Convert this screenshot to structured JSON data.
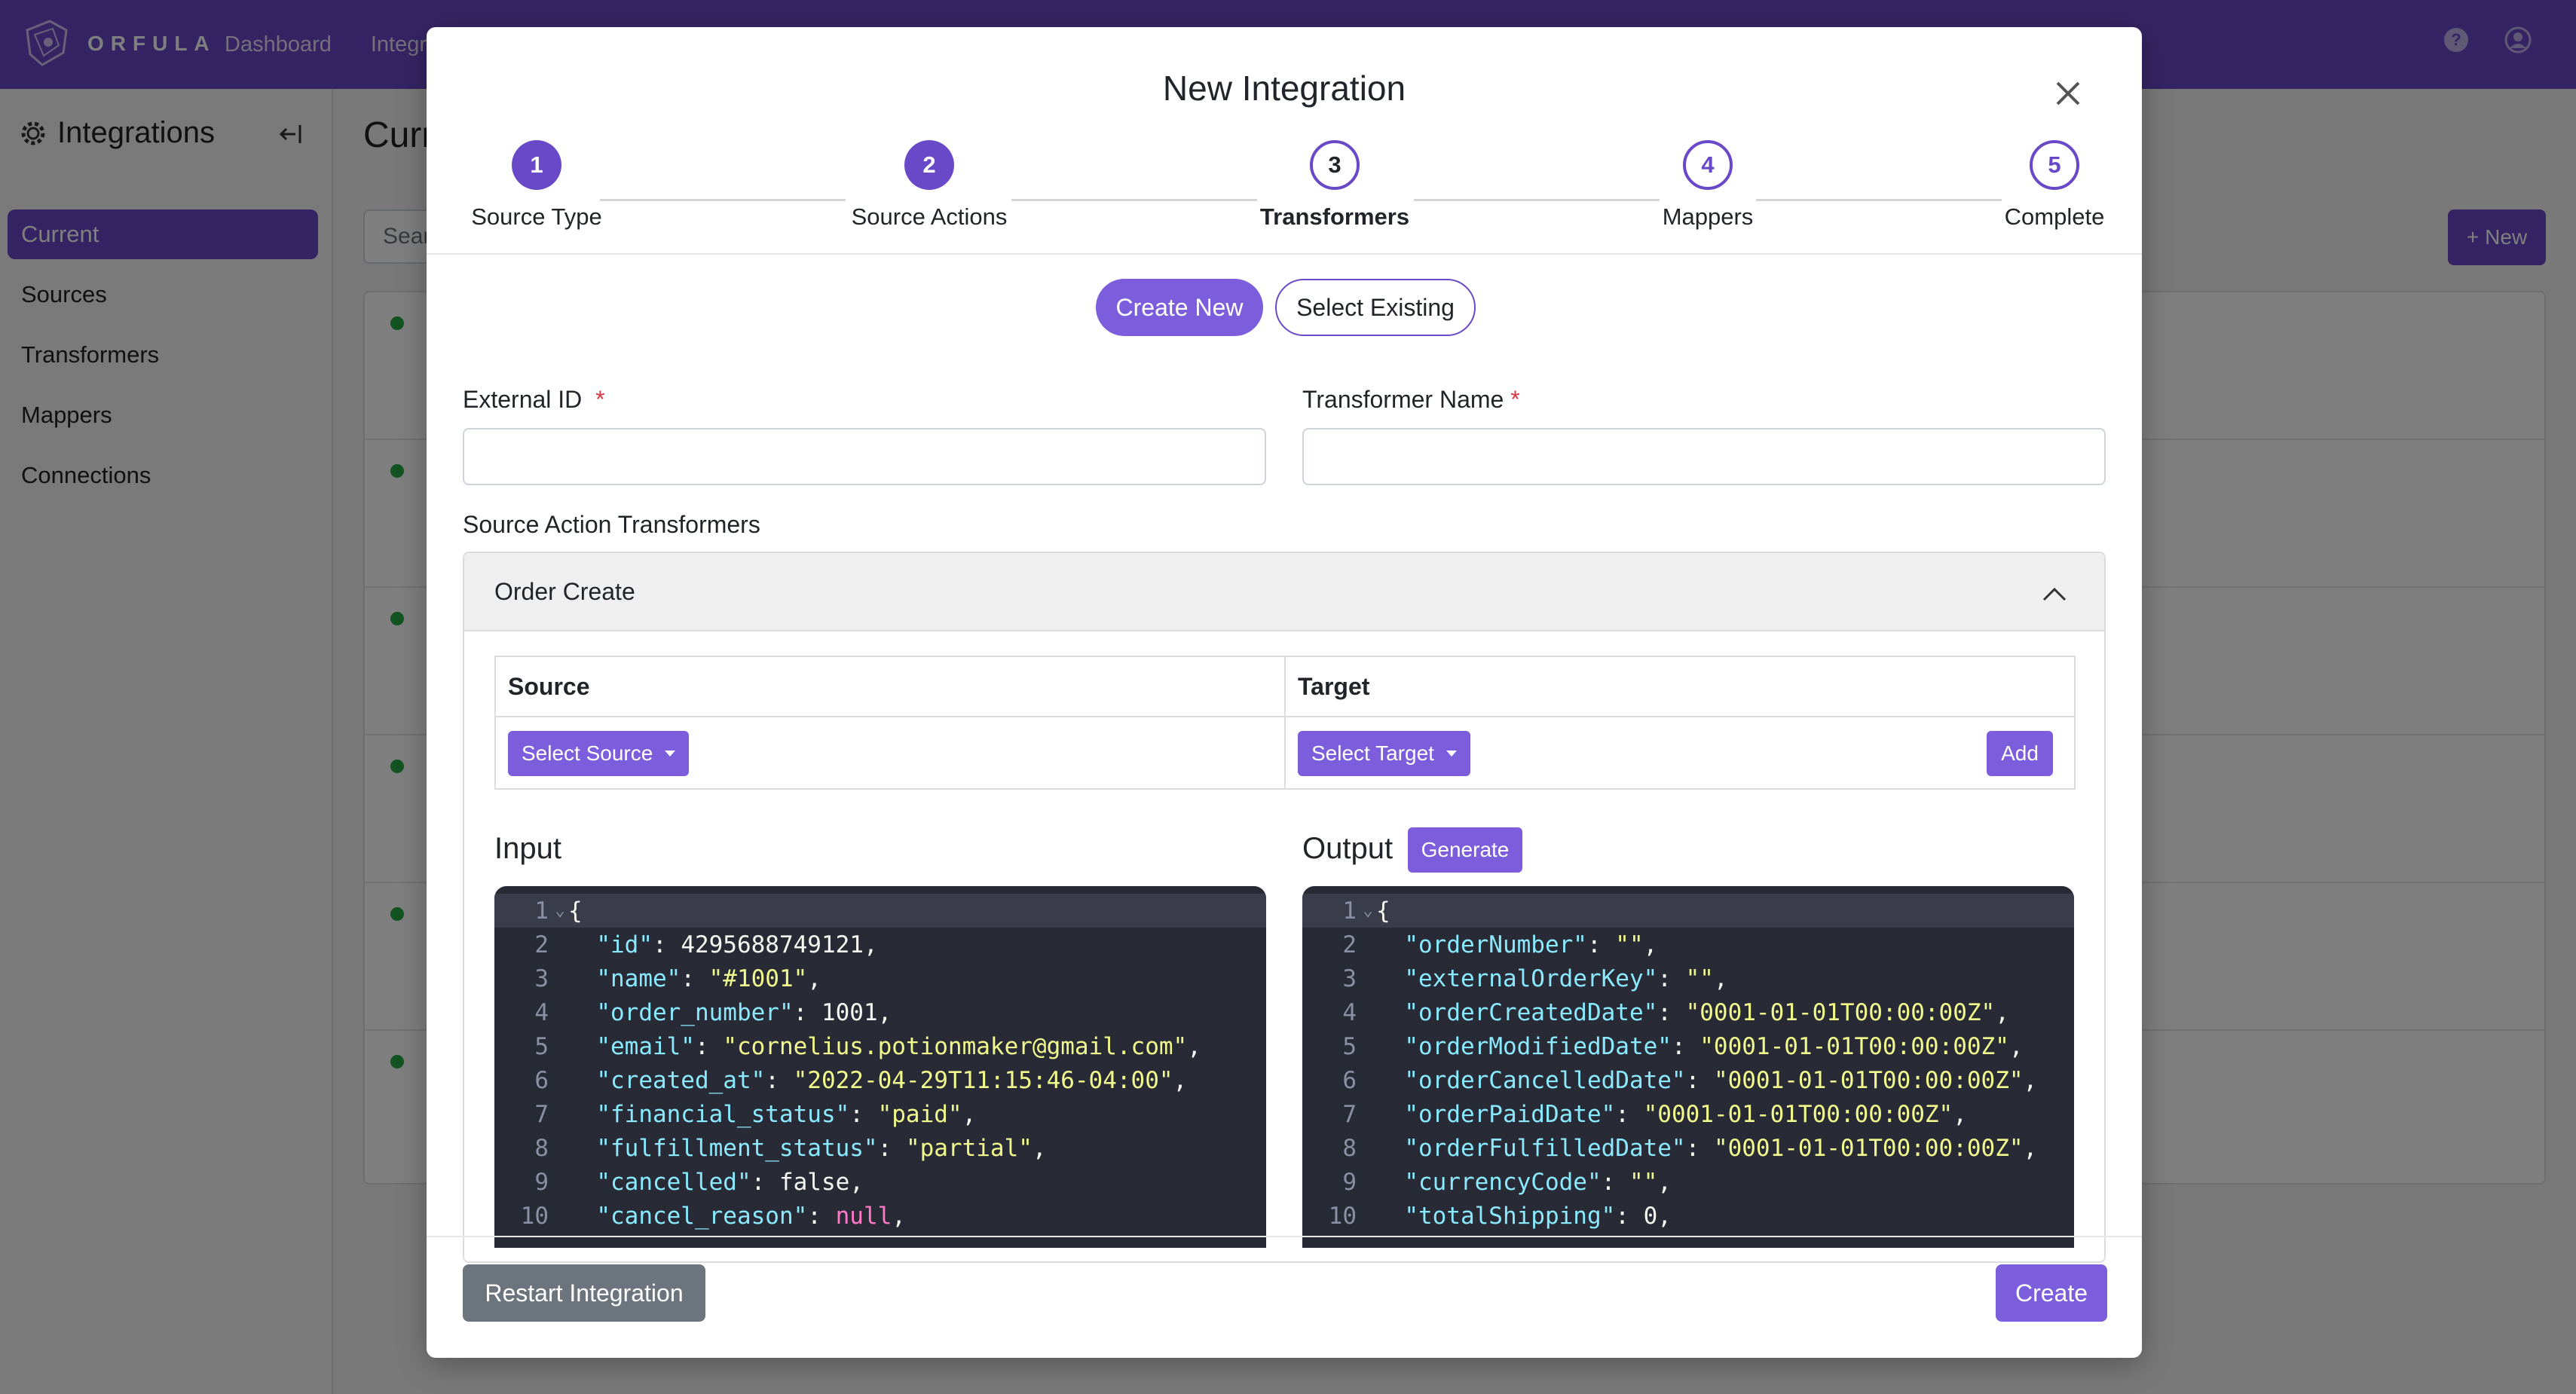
{
  "app": {
    "brand": "ORFULA",
    "nav": [
      "Dashboard",
      "Integrations"
    ]
  },
  "sidebar": {
    "title": "Integrations",
    "items": [
      {
        "label": "Current",
        "active": true
      },
      {
        "label": "Sources"
      },
      {
        "label": "Transformers"
      },
      {
        "label": "Mappers"
      },
      {
        "label": "Connections"
      }
    ]
  },
  "main": {
    "title": "Current",
    "search_placeholder": "Search",
    "new_button": "New"
  },
  "modal": {
    "title": "New Integration",
    "steps": [
      {
        "num": "1",
        "label": "Source Type",
        "state": "done"
      },
      {
        "num": "2",
        "label": "Source Actions",
        "state": "done"
      },
      {
        "num": "3",
        "label": "Transformers",
        "state": "current"
      },
      {
        "num": "4",
        "label": "Mappers",
        "state": "todo"
      },
      {
        "num": "5",
        "label": "Complete",
        "state": "todo"
      }
    ],
    "toggle": {
      "create_new": "Create New",
      "select_existing": "Select Existing"
    },
    "fields": {
      "external_id_label": "External ID",
      "external_id_value": "",
      "transformer_name_label": "Transformer Name",
      "transformer_name_value": "",
      "required_mark": "*"
    },
    "section_label": "Source Action Transformers",
    "accordion": {
      "title": "Order Create",
      "table": {
        "source_header": "Source",
        "target_header": "Target",
        "select_source": "Select Source",
        "select_target": "Select Target",
        "add": "Add"
      },
      "input_label": "Input",
      "output_label": "Output",
      "generate": "Generate",
      "input_code": [
        {
          "ln": "1",
          "text": "{"
        },
        {
          "ln": "2",
          "key": "\"id\"",
          "val": "4295688749121",
          "vt": "n",
          "trail": ","
        },
        {
          "ln": "3",
          "key": "\"name\"",
          "val": "\"#1001\"",
          "vt": "s",
          "trail": ","
        },
        {
          "ln": "4",
          "key": "\"order_number\"",
          "val": "1001",
          "vt": "n",
          "trail": ","
        },
        {
          "ln": "5",
          "key": "\"email\"",
          "val": "\"cornelius.potionmaker@gmail.com\"",
          "vt": "s",
          "trail": ","
        },
        {
          "ln": "6",
          "key": "\"created_at\"",
          "val": "\"2022-04-29T11:15:46-04:00\"",
          "vt": "s",
          "trail": ","
        },
        {
          "ln": "7",
          "key": "\"financial_status\"",
          "val": "\"paid\"",
          "vt": "s",
          "trail": ","
        },
        {
          "ln": "8",
          "key": "\"fulfillment_status\"",
          "val": "\"partial\"",
          "vt": "s",
          "trail": ","
        },
        {
          "ln": "9",
          "key": "\"cancelled\"",
          "val": "false",
          "vt": "n",
          "trail": ","
        },
        {
          "ln": "10",
          "key": "\"cancel_reason\"",
          "val": "null",
          "vt": "nl",
          "trail": ","
        }
      ],
      "output_code": [
        {
          "ln": "1",
          "text": "{"
        },
        {
          "ln": "2",
          "key": "\"orderNumber\"",
          "val": "\"\"",
          "vt": "s",
          "trail": ","
        },
        {
          "ln": "3",
          "key": "\"externalOrderKey\"",
          "val": "\"\"",
          "vt": "s",
          "trail": ","
        },
        {
          "ln": "4",
          "key": "\"orderCreatedDate\"",
          "val": "\"0001-01-01T00:00:00Z\"",
          "vt": "s",
          "trail": ","
        },
        {
          "ln": "5",
          "key": "\"orderModifiedDate\"",
          "val": "\"0001-01-01T00:00:00Z\"",
          "vt": "s",
          "trail": ","
        },
        {
          "ln": "6",
          "key": "\"orderCancelledDate\"",
          "val": "\"0001-01-01T00:00:00Z\"",
          "vt": "s",
          "trail": ","
        },
        {
          "ln": "7",
          "key": "\"orderPaidDate\"",
          "val": "\"0001-01-01T00:00:00Z\"",
          "vt": "s",
          "trail": ","
        },
        {
          "ln": "8",
          "key": "\"orderFulfilledDate\"",
          "val": "\"0001-01-01T00:00:00Z\"",
          "vt": "s",
          "trail": ","
        },
        {
          "ln": "9",
          "key": "\"currencyCode\"",
          "val": "\"\"",
          "vt": "s",
          "trail": ","
        },
        {
          "ln": "10",
          "key": "\"totalShipping\"",
          "val": "0",
          "vt": "n",
          "trail": ","
        }
      ]
    },
    "footer": {
      "restart": "Restart Integration",
      "create": "Create"
    }
  },
  "colors": {
    "brand": "#6a49c8",
    "button": "#7c5ddb",
    "secondary": "#6c757d",
    "required": "#dc3545"
  },
  "icons": [
    "orfula-logo-icon",
    "help-icon",
    "user-icon",
    "gear-icon",
    "collapse-sidebar-icon",
    "plus-icon",
    "close-icon",
    "chevron-up-icon",
    "caret-down-icon",
    "fold-arrow-icon"
  ]
}
